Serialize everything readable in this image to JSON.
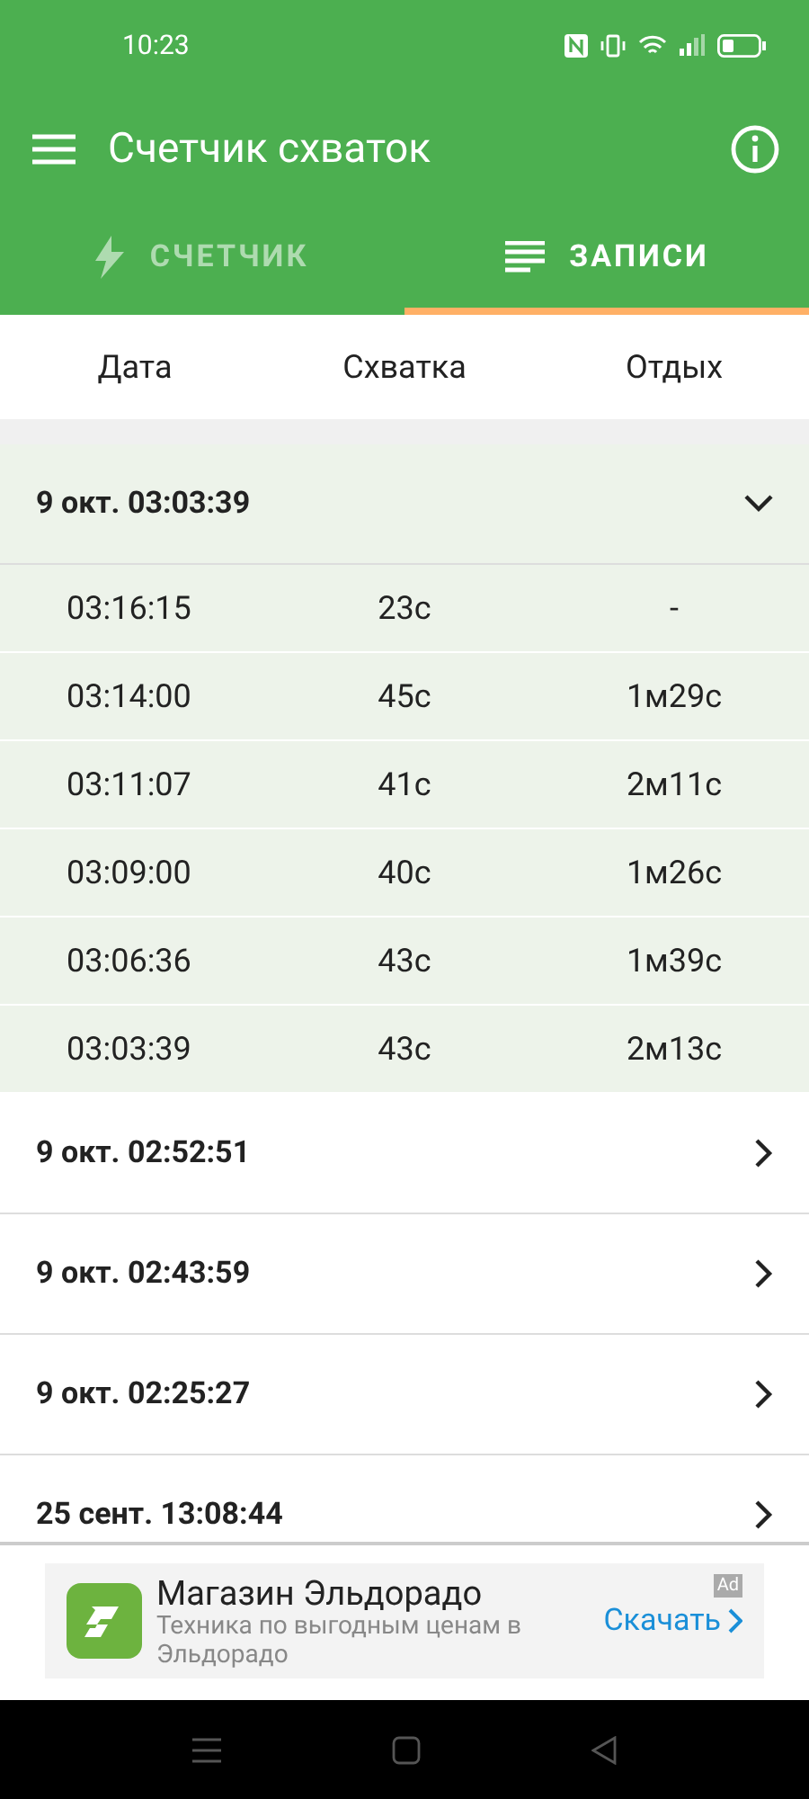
{
  "status_bar": {
    "time": "10:23"
  },
  "app_bar": {
    "title": "Счетчик схваток"
  },
  "tabs": [
    {
      "label": "СЧЕТЧИК",
      "kind": "counter",
      "selected": false
    },
    {
      "label": "ЗАПИСИ",
      "kind": "records",
      "selected": true
    }
  ],
  "table": {
    "columns": [
      "Дата",
      "Схватка",
      "Отдых"
    ],
    "groups": [
      {
        "title": "9 окт. 03:03:39",
        "expanded": true,
        "rows": [
          {
            "time": "03:16:15",
            "contraction": "23с",
            "rest": "-"
          },
          {
            "time": "03:14:00",
            "contraction": "45с",
            "rest": "1м29с"
          },
          {
            "time": "03:11:07",
            "contraction": "41с",
            "rest": "2м11с"
          },
          {
            "time": "03:09:00",
            "contraction": "40с",
            "rest": "1м26с"
          },
          {
            "time": "03:06:36",
            "contraction": "43с",
            "rest": "1м39с"
          },
          {
            "time": "03:03:39",
            "contraction": "43с",
            "rest": "2м13с"
          }
        ]
      },
      {
        "title": "9 окт. 02:52:51",
        "expanded": false
      },
      {
        "title": "9 окт. 02:43:59",
        "expanded": false
      },
      {
        "title": "9 окт. 02:25:27",
        "expanded": false
      },
      {
        "title": "25 сент. 13:08:44",
        "expanded": false
      }
    ]
  },
  "ad": {
    "title": "Магазин Эльдорадо",
    "description": "Техника по выгодным ценам в Эльдорадо",
    "action": "Скачать",
    "badge": "Ad"
  }
}
